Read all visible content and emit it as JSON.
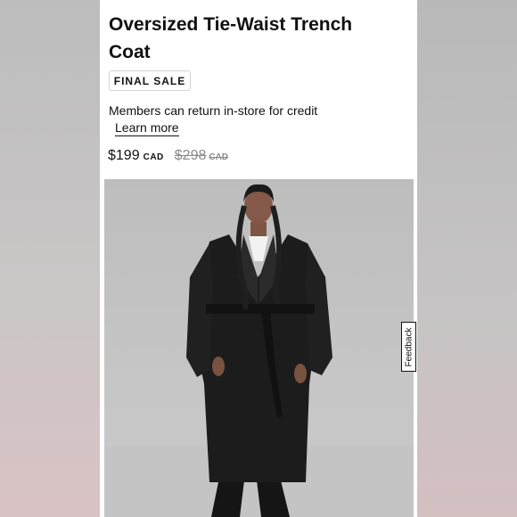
{
  "product": {
    "title": "Oversized Tie-Waist Trench Coat",
    "badge": "FINAL SALE",
    "return_note": "Members can return in-store for credit",
    "learn_more": "Learn more",
    "price": "$199",
    "currency": "CAD",
    "original_price": "$298",
    "original_currency": "CAD"
  },
  "feedback_tab": {
    "label": "Feedback"
  },
  "image": {
    "subject": "model-wearing-black-trench-coat"
  }
}
